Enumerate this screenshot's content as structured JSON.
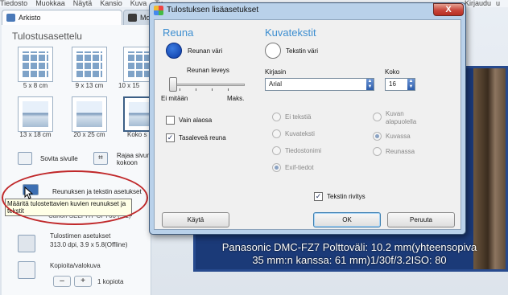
{
  "menubar": {
    "items": [
      "Tiedosto",
      "Muokkaa",
      "Näytä",
      "Kansio",
      "Kuva",
      "Ty"
    ],
    "right": [
      "Kirjaudu",
      "u"
    ]
  },
  "tabs": [
    {
      "label": "Arkisto"
    },
    {
      "label": "Movi"
    }
  ],
  "left_panel": {
    "title": "Tulostusasettelu",
    "layouts": [
      "5 x 8 cm",
      "9 x 13 cm",
      "10 x 15",
      "13 x 18 cm",
      "20 x 25 cm",
      "Koko s"
    ],
    "fit_label": "Sovita sivulle",
    "crop_label_line1": "Rajaa sivun",
    "crop_label_line2": "kokoon",
    "border_text_label": "Reunuksen ja tekstin asetukset",
    "tooltip": "Määritä tulostettavien kuvien reunukset ja tekstit",
    "printer_partial": "Canon SELPHY CP760 (...1)",
    "printer_settings_title": "Tulostimen asetukset",
    "printer_settings_value": "313.0 dpi, 3.9 x 5.8(Offline)",
    "copies_title": "Kopioita/valokuva",
    "copies_minus": "–",
    "copies_plus": "+",
    "copies_value": "1 kopiota"
  },
  "preview": {
    "caption_line1": "Panasonic DMC-FZ7 Polttoväli: 10.2 mm(yhteensopiva",
    "caption_line2": "35 mm:n kanssa: 61 mm)1/30f/3.2ISO: 80"
  },
  "dialog": {
    "title": "Tulostuksen lisäasetukset",
    "close_symbol": "X",
    "border": {
      "section_title": "Reuna",
      "color_label": "Reunan väri",
      "width_label": "Reunan leveys",
      "min_label": "Ei mitään",
      "max_label": "Maks.",
      "bottom_only_label": "Vain alaosa",
      "bottom_only_checked": false,
      "even_border_label": "Tasaleveä reuna",
      "even_border_checked": true
    },
    "caption": {
      "section_title": "Kuvatekstit",
      "text_color_label": "Tekstin väri",
      "font_label": "Kirjasin",
      "font_value": "Arial",
      "size_label": "Koko",
      "size_value": "16",
      "content_options": [
        "Ei tekstiä",
        "Kuvateksti",
        "Tiedostonimi",
        "Exif-tiedot"
      ],
      "content_selected": "Exif-tiedot",
      "position_options": [
        "Kuvan alapuolella",
        "Kuvassa",
        "Reunassa"
      ],
      "position_selected": "Kuvassa",
      "wrap_label": "Tekstin rivitys",
      "wrap_checked": true
    },
    "buttons": {
      "apply": "Käytä",
      "ok": "OK",
      "cancel": "Peruuta"
    }
  },
  "colors": {
    "accent_heading": "#3d8ed0",
    "border_color_swatch": "#0b3aa6",
    "text_color_swatch": "#ffffff",
    "annotation_red": "#c0282a"
  }
}
